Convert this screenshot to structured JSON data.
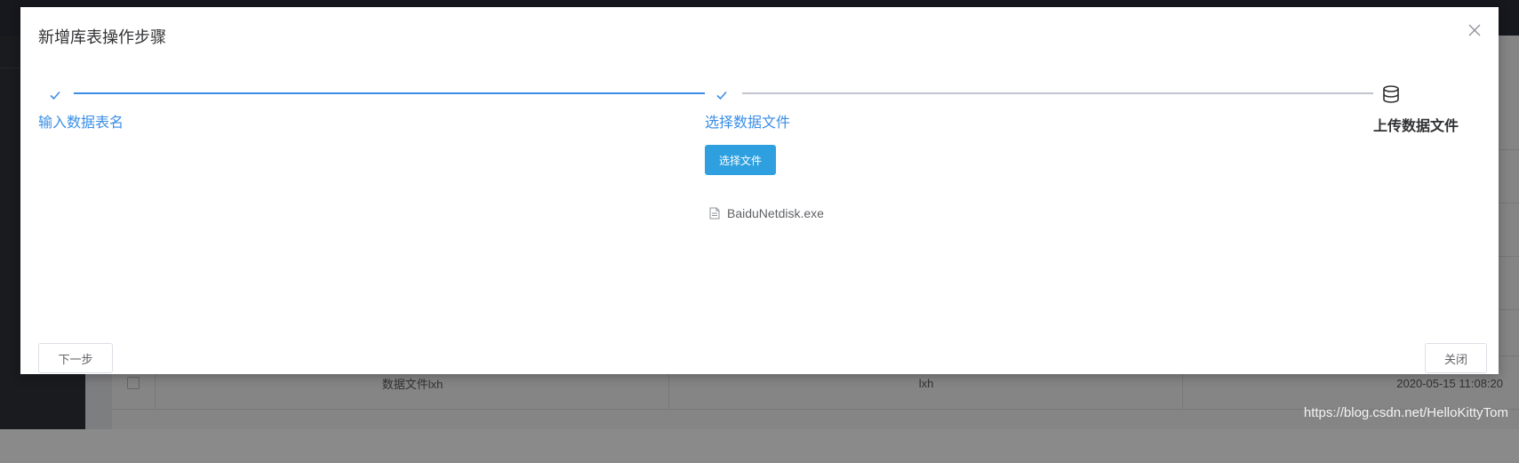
{
  "dialog": {
    "title": "新增库表操作步骤",
    "close_icon": "close-icon",
    "steps": [
      {
        "title": "输入数据表名",
        "status": "finish",
        "icon": "check-icon"
      },
      {
        "title": "选择数据文件",
        "status": "finish",
        "icon": "check-icon"
      },
      {
        "title": "上传数据文件",
        "status": "process",
        "icon": "database-icon"
      }
    ],
    "upload": {
      "button_label": "选择文件",
      "file_name": "BaiduNetdisk.exe",
      "file_icon": "document-icon"
    },
    "footer": {
      "next_label": "下一步",
      "close_label": "关闭"
    }
  },
  "background": {
    "row": {
      "name": "数据文件lxh",
      "user": "lxh",
      "time": "2020-05-15 11:08:20"
    }
  },
  "watermark": "https://blog.csdn.net/HelloKittyTom",
  "colors": {
    "finished": "#3a8ee6",
    "upload_button": "#2ea0e0",
    "pending_line": "#c0c4cc"
  }
}
